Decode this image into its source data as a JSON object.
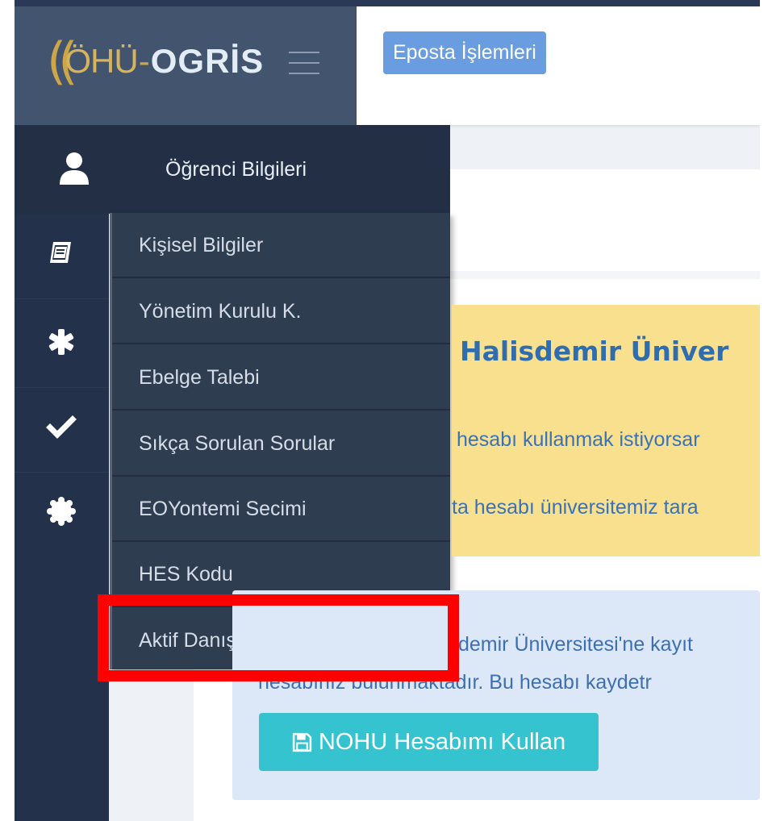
{
  "header": {
    "logo_ohu": "ÖHÜ",
    "logo_dash": "-",
    "logo_ogris": "OGRİS",
    "eposta_button": "Eposta İşlemleri"
  },
  "sidebar": {
    "active_section": "Öğrenci Bilgileri",
    "strip_icons": [
      "user-icon",
      "book-icon",
      "asterisk-icon",
      "check-icon",
      "badge-icon"
    ],
    "submenu": [
      "Kişisel Bilgiler",
      "Yönetim Kurulu K.",
      "Ebelge Talebi",
      "Sıkça Sorulan Sorular",
      "EOYontemi Secimi",
      "HES Kodu",
      "Aktif Danışmanlık"
    ],
    "highlighted_item": "Aktif Danışmanlık"
  },
  "main": {
    "warning": {
      "title": "Halisdemir Üniver",
      "line1": "hesabı kullanmak istiyorsar",
      "line2": "ta hesabı üniversitemiz tara"
    },
    "info": {
      "line1": "demir Üniversitesi'ne kayıt",
      "line2": "hesabınız bulunmaktadır. Bu hesabı kaydetr"
    },
    "nohu_button": "NOHU Hesabımı Kullan"
  },
  "colors": {
    "highlight": "#ff0000",
    "sidebar_dark": "#23314a",
    "logo_gold": "#cda64a",
    "warning_bg": "#f8e08f",
    "info_bg": "#dce8f8",
    "button_teal": "#35c3cf"
  }
}
